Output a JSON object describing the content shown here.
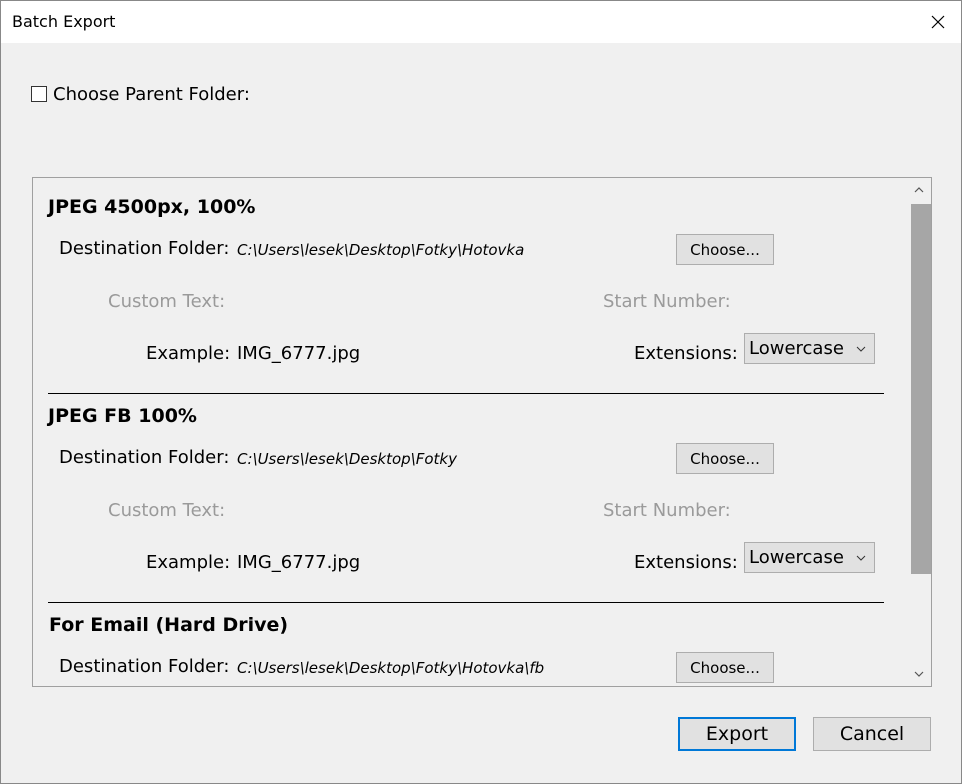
{
  "window": {
    "title": "Batch Export"
  },
  "parent_folder": {
    "label": "Choose Parent Folder:",
    "checked": false
  },
  "labels": {
    "destination": "Destination Folder:",
    "custom_text": "Custom Text:",
    "start_number": "Start Number:",
    "example": "Example:",
    "extensions": "Extensions:"
  },
  "presets": [
    {
      "name": "JPEG 4500px, 100%",
      "destination": "C:\\Users\\lesek\\Desktop\\Fotky\\Hotovka",
      "choose_label": "Choose...",
      "example": "IMG_6777.jpg",
      "extensions": "Lowercase"
    },
    {
      "name": "JPEG FB 100%",
      "destination": "C:\\Users\\lesek\\Desktop\\Fotky",
      "choose_label": "Choose...",
      "example": "IMG_6777.jpg",
      "extensions": "Lowercase"
    },
    {
      "name": "For Email (Hard Drive)",
      "destination": "C:\\Users\\lesek\\Desktop\\Fotky\\Hotovka\\fb",
      "choose_label": "Choose..."
    }
  ],
  "footer": {
    "export_label": "Export",
    "cancel_label": "Cancel"
  },
  "icons": {
    "close": "close-icon",
    "scroll_up": "chevron-up-icon",
    "scroll_down": "chevron-down-icon",
    "dropdown": "chevron-down-icon"
  }
}
